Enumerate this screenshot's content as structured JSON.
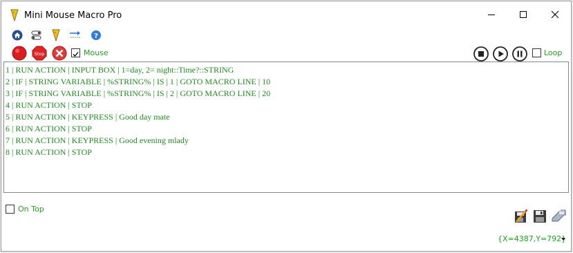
{
  "window": {
    "title": "Mini Mouse Macro Pro"
  },
  "toolbar": {
    "mouse_label": "Mouse",
    "loop_label": "Loop",
    "mouse_checked": true,
    "loop_checked": false
  },
  "macro_lines": [
    "1 | RUN ACTION | INPUT BOX | 1=day, 2= night::Time?::STRING",
    "2 | IF | STRING VARIABLE | %STRING% | IS | 1 | GOTO MACRO LINE | 10",
    "3 | IF | STRING VARIABLE | %STRING% | IS | 2 | GOTO MACRO LINE | 20",
    "4 | RUN ACTION | STOP",
    "5 | RUN ACTION | KEYPRESS | Good day mate",
    "6 | RUN ACTION | STOP",
    "7 | RUN ACTION | KEYPRESS | Good evening mlady",
    "8 | RUN ACTION | STOP"
  ],
  "footer": {
    "on_top_label": "On Top",
    "on_top_checked": false,
    "coords": "{X=4387,Y=792}"
  },
  "colors": {
    "accent_green": "#1fa01f",
    "macro_text": "#1f8c1f"
  }
}
